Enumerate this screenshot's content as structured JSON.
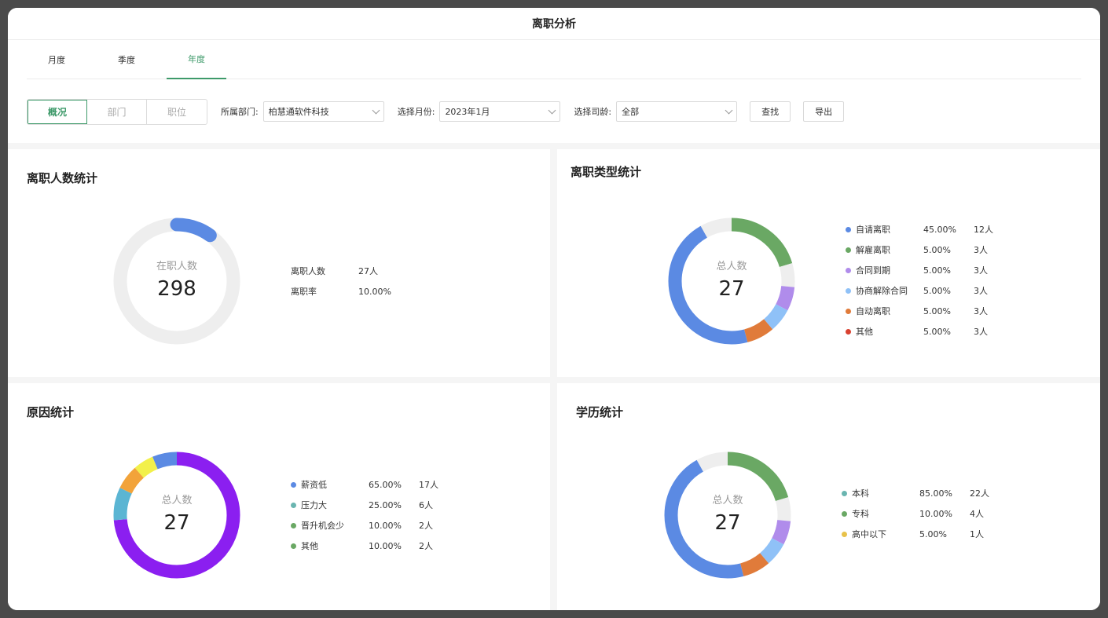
{
  "window": {
    "title": "离职分析"
  },
  "tabs": [
    {
      "label": "月度",
      "active": false
    },
    {
      "label": "季度",
      "active": false
    },
    {
      "label": "年度",
      "active": true
    }
  ],
  "segments": [
    {
      "label": "概况",
      "active": true
    },
    {
      "label": "部门",
      "active": false
    },
    {
      "label": "职位",
      "active": false
    }
  ],
  "filters": {
    "dept_label": "所属部门:",
    "dept_value": "柏慧通软件科技",
    "month_label": "选择月份:",
    "month_value": "2023年1月",
    "tenure_label": "选择司龄:",
    "tenure_value": "全部",
    "search_btn": "查找",
    "export_btn": "导出"
  },
  "colors": {
    "accent": "#3e9a6a",
    "track": "#eeeeee"
  },
  "cards": {
    "headcount": {
      "title": "离职人数统计",
      "caption": "在职人数",
      "value": "298",
      "progress_fraction": 0.1,
      "progress_color": "#5b8ae3",
      "stats": [
        {
          "label": "离职人数",
          "value": "27人"
        },
        {
          "label": "离职率",
          "value": "10.00%"
        }
      ]
    },
    "types": {
      "title": "离职类型统计",
      "caption": "总人数",
      "value": "27",
      "legend": [
        {
          "name": "自请离职",
          "pct": "45.00%",
          "count": "12人",
          "color": "#5b8ae3"
        },
        {
          "name": "解雇离职",
          "pct": "5.00%",
          "count": "3人",
          "color": "#6aa864"
        },
        {
          "name": "合同到期",
          "pct": "5.00%",
          "count": "3人",
          "color": "#b08ceb"
        },
        {
          "name": "协商解除合同",
          "pct": "5.00%",
          "count": "3人",
          "color": "#8fc1f7"
        },
        {
          "name": "自动离职",
          "pct": "5.00%",
          "count": "3人",
          "color": "#e07b3a"
        },
        {
          "name": "其他",
          "pct": "5.00%",
          "count": "3人",
          "color": "#d94130"
        }
      ]
    },
    "reasons": {
      "title": "原因统计",
      "caption": "总人数",
      "value": "27",
      "legend": [
        {
          "name": "薪资低",
          "pct": "65.00%",
          "count": "17人",
          "color": "#5b8ae3"
        },
        {
          "name": "压力大",
          "pct": "25.00%",
          "count": "6人",
          "color": "#6ab5b0"
        },
        {
          "name": "晋升机会少",
          "pct": "10.00%",
          "count": "2人",
          "color": "#6aa864"
        },
        {
          "name": "其他",
          "pct": "10.00%",
          "count": "2人",
          "color": "#6aa864"
        }
      ]
    },
    "education": {
      "title": "学历统计",
      "caption": "总人数",
      "value": "27",
      "legend": [
        {
          "name": "本科",
          "pct": "85.00%",
          "count": "22人",
          "color": "#6ab5b0"
        },
        {
          "name": "专科",
          "pct": "10.00%",
          "count": "4人",
          "color": "#6aa864"
        },
        {
          "name": "高中以下",
          "pct": "5.00%",
          "count": "1人",
          "color": "#e8c24a"
        }
      ]
    }
  },
  "donut_segments": {
    "types": [
      {
        "color": "#5b8ae3",
        "value": 45
      },
      {
        "color": "#eeeeee",
        "value": 8
      },
      {
        "color": "#6aa864",
        "value": 20
      },
      {
        "color": "#eeeeee",
        "value": 6
      },
      {
        "color": "#b08ceb",
        "value": 6
      },
      {
        "color": "#8fc1f7",
        "value": 6
      },
      {
        "color": "#e07b3a",
        "value": 7
      }
    ],
    "reasons": [
      {
        "color": "#8b1ff0",
        "value": 70
      },
      {
        "color": "#5bb5d3",
        "value": 8
      },
      {
        "color": "#f2a33a",
        "value": 6
      },
      {
        "color": "#f2f04a",
        "value": 5
      },
      {
        "color": "#5b8ae3",
        "value": 6
      }
    ],
    "education": [
      {
        "color": "#5b8ae3",
        "value": 45
      },
      {
        "color": "#eeeeee",
        "value": 8
      },
      {
        "color": "#6aa864",
        "value": 20
      },
      {
        "color": "#eeeeee",
        "value": 6
      },
      {
        "color": "#b08ceb",
        "value": 6
      },
      {
        "color": "#8fc1f7",
        "value": 6
      },
      {
        "color": "#e07b3a",
        "value": 7
      }
    ]
  }
}
